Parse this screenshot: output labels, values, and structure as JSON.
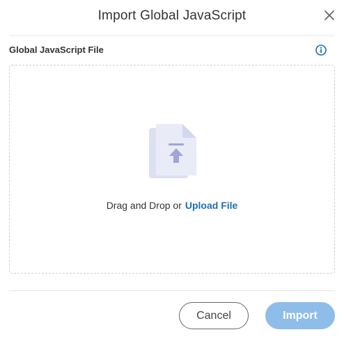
{
  "dialog": {
    "title": "Import Global JavaScript",
    "close_icon": "close-icon"
  },
  "field": {
    "label": "Global JavaScript File",
    "info_icon": "info-icon"
  },
  "dropzone": {
    "icon": "file-upload-icon",
    "prompt": "Drag and Drop or",
    "upload_link": "Upload File"
  },
  "footer": {
    "cancel_label": "Cancel",
    "import_label": "Import"
  },
  "colors": {
    "link": "#1a6fb5",
    "import_button_disabled": "#8fbde9",
    "info_icon": "#1a6fb5",
    "file_icon_back": "#dde0f2",
    "file_icon_front": "#e9ebf7",
    "file_icon_arrow": "#9fa6d6"
  }
}
